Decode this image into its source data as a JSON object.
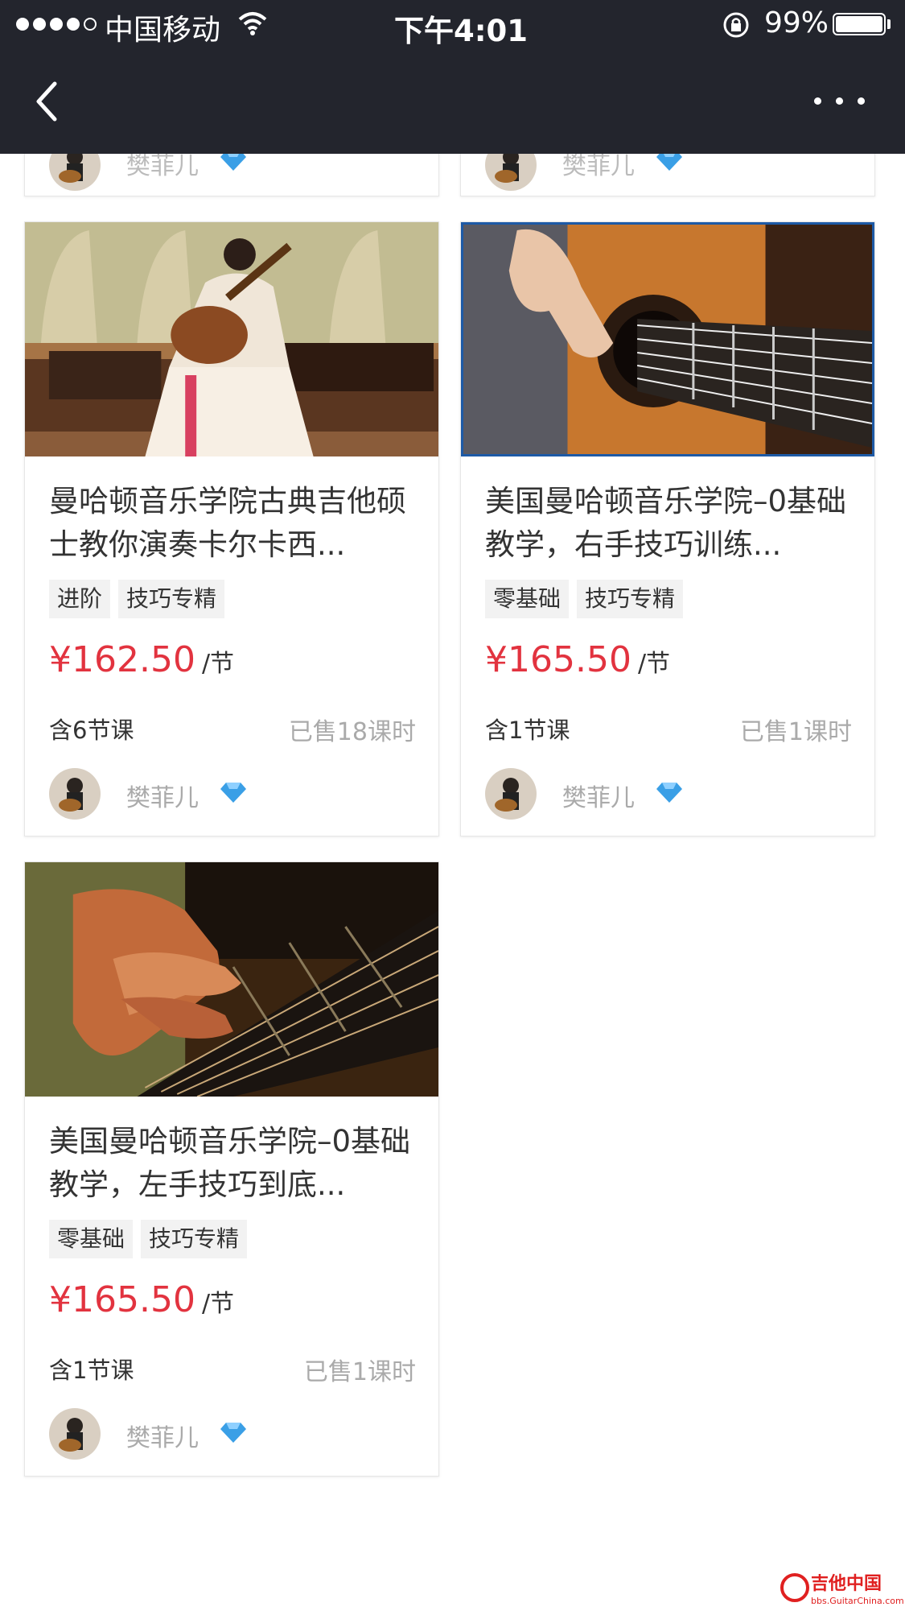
{
  "status_bar": {
    "carrier": "中国移动",
    "time": "下午4:01",
    "battery": "99%"
  },
  "colors": {
    "nav_bg": "#23252d",
    "price": "#e2333f",
    "tag_bg": "#f2f2f2",
    "muted_text": "#aaaaaa",
    "gem": "#3a9fe6"
  },
  "icons": {
    "back": "chevron-left-icon",
    "more": "more-dots-icon",
    "wifi": "wifi-icon",
    "orientation_lock": "orientation-lock-icon",
    "vip": "diamond-icon"
  },
  "partial_cards": [
    {
      "author": "樊菲儿"
    },
    {
      "author": "樊菲儿"
    }
  ],
  "courses": [
    {
      "title": "曼哈顿音乐学院古典吉他硕士教你演奏卡尔卡西...",
      "tags": [
        "进阶",
        "技巧专精"
      ],
      "price": "¥162.50",
      "unit": "/节",
      "lessons": "含6节课",
      "sold": "已售18课时",
      "author": "樊菲儿"
    },
    {
      "title": "美国曼哈顿音乐学院–0基础教学，右手技巧训练...",
      "tags": [
        "零基础",
        "技巧专精"
      ],
      "price": "¥165.50",
      "unit": "/节",
      "lessons": "含1节课",
      "sold": "已售1课时",
      "author": "樊菲儿"
    },
    {
      "title": "美国曼哈顿音乐学院–0基础教学，左手技巧到底...",
      "tags": [
        "零基础",
        "技巧专精"
      ],
      "price": "¥165.50",
      "unit": "/节",
      "lessons": "含1节课",
      "sold": "已售1课时",
      "author": "樊菲儿"
    }
  ],
  "watermark": {
    "text": "吉他中国",
    "url_text": "bbs.GuitarChina.com"
  }
}
